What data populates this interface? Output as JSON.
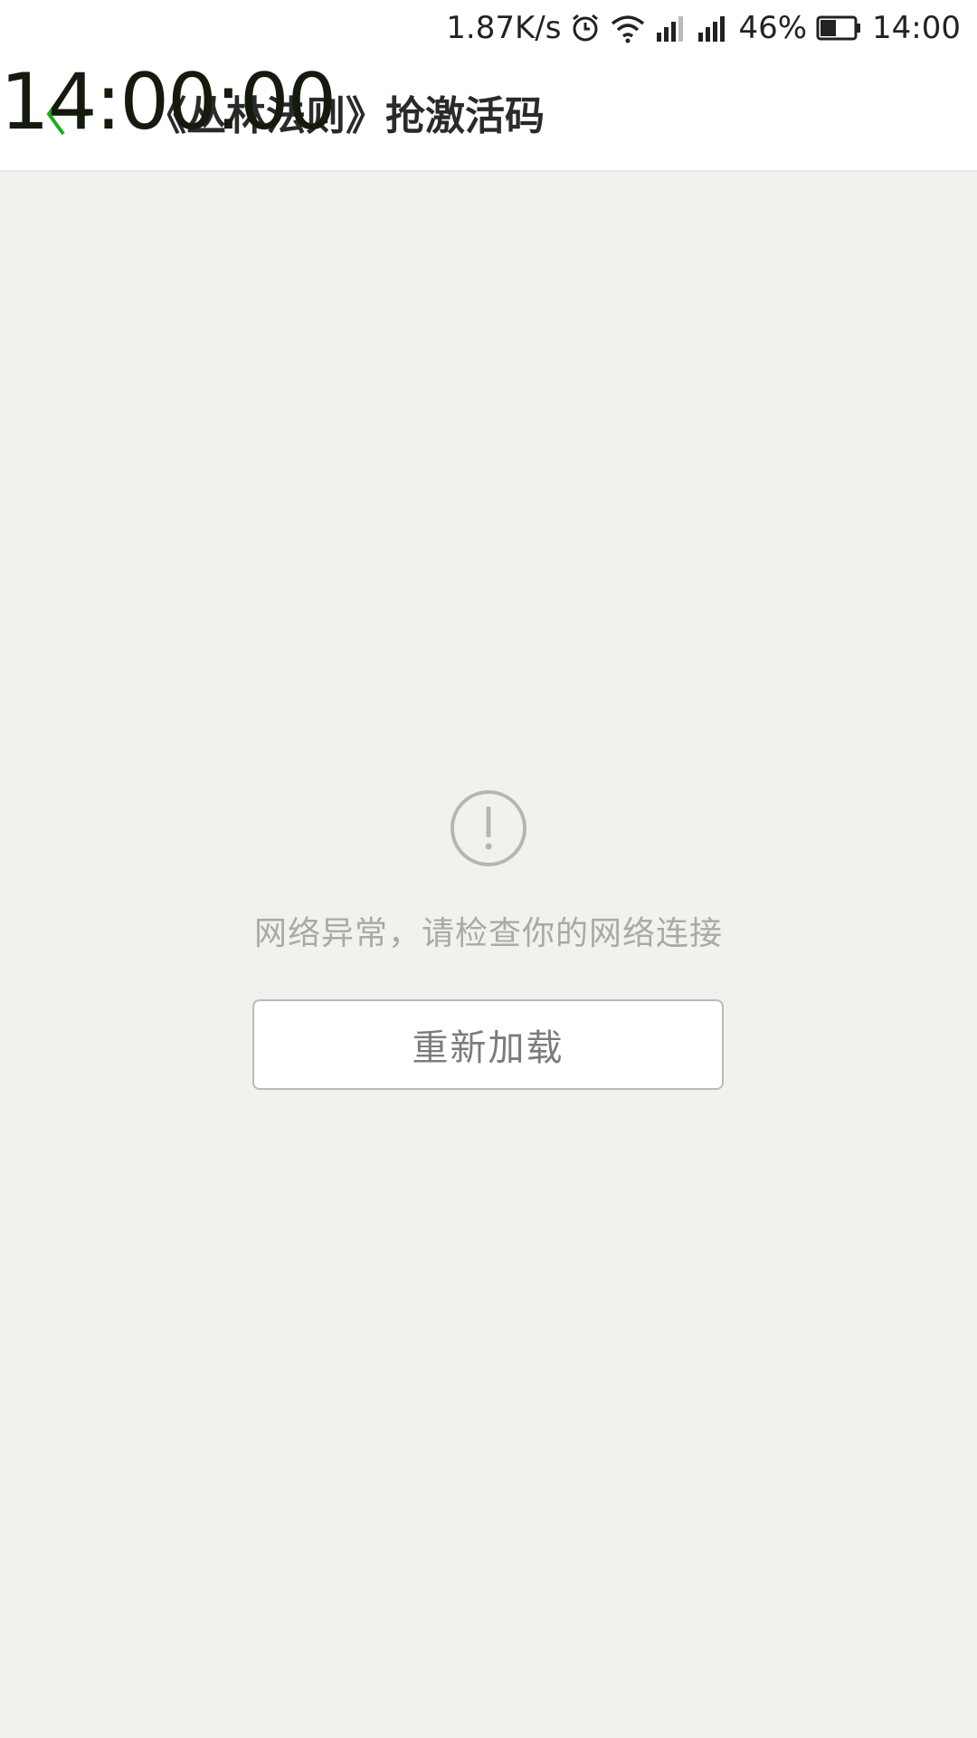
{
  "status_bar": {
    "network_speed": "1.87K/s",
    "battery_percent": "46%",
    "time": "14:00",
    "icons": [
      "alarm-icon",
      "wifi-icon",
      "signal-icon",
      "signal-icon",
      "battery-icon"
    ],
    "battery_level": 0.46
  },
  "overlay": {
    "clock": "14:00:00"
  },
  "header": {
    "title": "《丛林法则》抢激活码",
    "back_icon": "arrow-left-icon",
    "accent_color": "#1aad19"
  },
  "error": {
    "icon": "exclamation-circle-icon",
    "message": "网络异常，请检查你的网络连接",
    "reload_label": "重新加载"
  }
}
